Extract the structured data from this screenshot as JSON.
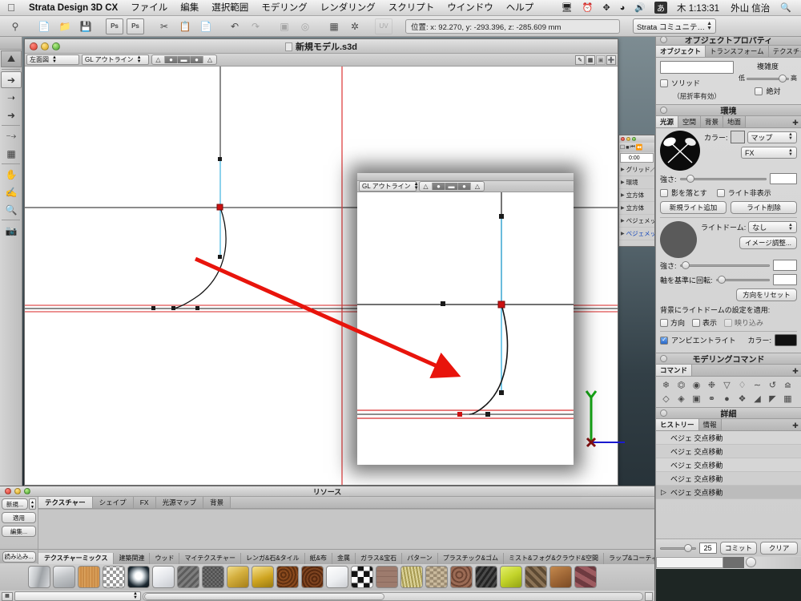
{
  "menubar": {
    "apple_icon": "apple-icon",
    "app_name": "Strata Design 3D CX",
    "items": [
      "ファイル",
      "編集",
      "選択範囲",
      "モデリング",
      "レンダリング",
      "スクリプト",
      "ウインドウ",
      "ヘルプ"
    ],
    "status_icons": [
      "display-icon",
      "time-machine-icon",
      "bluetooth-icon",
      "wifi-icon",
      "volume-icon"
    ],
    "ime": "あ",
    "clock": "木 1:13:31",
    "user": "外山 信治",
    "search_icon": "search-icon"
  },
  "toolbar": {
    "icons": [
      "eyedropper-icon",
      "new-document-icon",
      "open-folder-icon",
      "save-icon",
      "photoshop-import-icon",
      "photoshop-export-icon",
      "cut-icon",
      "copy-icon",
      "paste-icon",
      "undo-icon",
      "redo-icon",
      "group-icon",
      "align-icon",
      "distribute-icon",
      "transform-icon",
      "uv-icon"
    ],
    "position_field": "位置: x: 92.270, y: -293.396, z: -285.609 mm",
    "community_popup": "Strata コミュニテ…"
  },
  "tool_palette": {
    "tools": [
      "magnet-tool",
      "arrow-select-tool",
      "point-select-tool",
      "rotate-select-tool",
      "line-tool",
      "grid-tool",
      "hand-tool",
      "orbit-tool",
      "zoom-tool",
      "render-region-tool"
    ],
    "selected_index": 1
  },
  "document": {
    "title": "新規モデル.s3d",
    "view_popup": "左面図",
    "render_popup": "GL アウトライン",
    "segment_labels": [
      "wireframe-mode",
      "shaded-mode",
      "textured-mode",
      "preview-mode"
    ],
    "segment_active_index": 1,
    "corner_icons": [
      "pen-icon",
      "grid-icon",
      "layer-icon",
      "add-view-icon"
    ]
  },
  "object_list": {
    "time": "0:00",
    "rows": [
      {
        "label": "グリッド／ス",
        "selected": false
      },
      {
        "label": "環境",
        "selected": false
      },
      {
        "label": "立方体",
        "selected": false
      },
      {
        "label": "立方体",
        "selected": false
      },
      {
        "label": "ベジェメッ",
        "selected": false
      },
      {
        "label": "ベジェメッ",
        "selected": true
      }
    ]
  },
  "right_panel": {
    "top_icons": [
      "list-view-icon",
      "outline-view-icon",
      "object-properties-icon",
      "environment-icon",
      "render-icon",
      "animation-icon",
      "texture-icon",
      "movie-icon"
    ],
    "object_properties": {
      "header": "オブジェクトプロパティ",
      "tabs": [
        "オブジェクト",
        "トランスフォーム",
        "テクスチャー"
      ],
      "active_tab_index": 0,
      "name_value": "",
      "solid_label": "ソリッド",
      "solid_checked": false,
      "refraction_label": "（屈折率有効）",
      "complexity_label": "複雑度",
      "complexity_low": "低",
      "complexity_high": "高",
      "complexity_value": 92,
      "absolute_label": "絶対",
      "absolute_checked": false
    },
    "environment": {
      "header": "環境",
      "tabs": [
        "光源",
        "空間",
        "背景",
        "地面"
      ],
      "active_tab_index": 0,
      "color_label": "カラー:",
      "map_popup": "マップ",
      "fx_popup": "FX",
      "strength_label": "強さ:",
      "strength_value": 12,
      "cast_shadow_label": "影を落とす",
      "cast_shadow_checked": false,
      "hide_light_label": "ライト非表示",
      "hide_light_checked": false,
      "new_light_button": "新規ライト追加",
      "delete_light_button": "ライト削除",
      "lightdome_label": "ライトドーム:",
      "lightdome_popup": "なし",
      "image_adjust_button": "イメージ調整...",
      "dome_strength_label": "強さ:",
      "dome_strength_value": 6,
      "axis_rotate_label": "軸を基準に回転:",
      "axis_rotate_value": 6,
      "reset_direction_button": "方向をリセット",
      "apply_dome_label": "背景にライトドームの設定を適用:",
      "apply_direction": "方向",
      "apply_display": "表示",
      "apply_reflection": "映り込み",
      "ambient_label": "アンビエントライト",
      "ambient_checked": true,
      "ambient_color_label": "カラー:",
      "ambient_color": "#1a1a1a"
    },
    "modeling": {
      "header": "モデリングコマンド",
      "tab": "コマンド",
      "row1_icons": [
        "skeleton-icon",
        "extrude-icon",
        "lathe-icon",
        "deform-icon",
        "taper-icon",
        "twist-icon",
        "path-icon",
        "bend-icon",
        "uv-icon"
      ],
      "row2_icons": [
        "surface-icon",
        "loft-icon",
        "boolean-icon",
        "shell-icon",
        "sphere-deform-icon",
        "explode-icon",
        "bevel-icon",
        "mirror-icon",
        "duplicate-icon"
      ]
    },
    "detail": {
      "header": "詳細",
      "tabs": [
        "ヒストリー",
        "情報"
      ],
      "active_tab_index": 0,
      "history": [
        {
          "label": "ベジェ 交点移動",
          "selected": false
        },
        {
          "label": "ベジェ 交点移動",
          "selected": false
        },
        {
          "label": "ベジェ 交点移動",
          "selected": false
        },
        {
          "label": "ベジェ 交点移動",
          "selected": false
        },
        {
          "label": "ベジェ 交点移動",
          "selected": true
        }
      ]
    },
    "footer": {
      "slider_value": 25,
      "commit_button": "コミット",
      "clear_button": "クリア"
    }
  },
  "resource_window": {
    "title": "リソース",
    "side_buttons": [
      "新規...",
      "適用",
      "編集...",
      "読み込み..."
    ],
    "tabs": [
      "テクスチャー",
      "シェイプ",
      "FX",
      "光源マップ",
      "背景"
    ],
    "active_tab_index": 0,
    "category_tabs": [
      "テクスチャーミックス",
      "建築関連",
      "ウッド",
      "マイテクスチャー",
      "レンガ&石&タイル",
      "紙&布",
      "金属",
      "ガラス&宝石",
      "パターン",
      "プラスチック&ゴム",
      "ミスト&フォグ&クラウド&空間",
      "ラップ&コーティング"
    ],
    "active_category_index": 0,
    "swatches": [
      {
        "name": "brushed-metal",
        "color": "#c8c9cb"
      },
      {
        "name": "satin-metal",
        "color": "#c0c3c6"
      },
      {
        "name": "pine-wood",
        "color": "#d59a56"
      },
      {
        "name": "checker-blur",
        "color": "#d8d8d8"
      },
      {
        "name": "cloud-sky",
        "color": "#20262d"
      },
      {
        "name": "white-gloss",
        "color": "#e8e9ec"
      },
      {
        "name": "dark-stripe",
        "color": "#6a6a6a"
      },
      {
        "name": "dark-grid",
        "color": "#5e5e5e"
      },
      {
        "name": "gold-plate",
        "color": "#d3ae3d"
      },
      {
        "name": "gold-solid",
        "color": "#c9a521"
      },
      {
        "name": "cork",
        "color": "#8a4a1d"
      },
      {
        "name": "rust-cork",
        "color": "#7e4420"
      },
      {
        "name": "white-plastic",
        "color": "#f0f1f3"
      },
      {
        "name": "checker-bw",
        "color": "#ffffff"
      },
      {
        "name": "brick-tile",
        "color": "#9d7b6d"
      },
      {
        "name": "straw",
        "color": "#c9bd6f"
      },
      {
        "name": "stone-wall",
        "color": "#b3a38c"
      },
      {
        "name": "cobble",
        "color": "#7c5646"
      },
      {
        "name": "carbon-fiber",
        "color": "#3b3b3b"
      },
      {
        "name": "lime-gloss",
        "color": "#c2d32a"
      },
      {
        "name": "diamond-plate",
        "color": "#6b5b4a"
      },
      {
        "name": "leather",
        "color": "#9c6434"
      },
      {
        "name": "marble-red",
        "color": "#8d5157"
      }
    ],
    "swatch_popup": ""
  },
  "annotation": {
    "arrow_color": "#e8140c",
    "arrow_name": "red-pointer-arrow"
  },
  "viewport": {
    "axis_y_label": "Y",
    "axis_x_label": "X",
    "guide_color": "#e05050",
    "curve_color": "#111111",
    "handle_color": "#3fb3e0",
    "node_color": "#cc1111"
  }
}
